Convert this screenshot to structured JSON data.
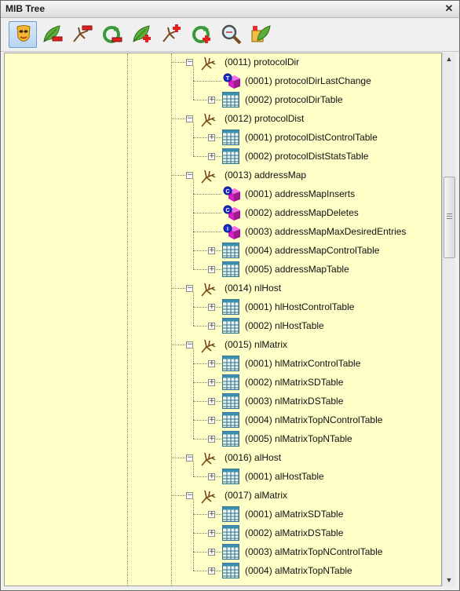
{
  "window": {
    "title": "MIB Tree",
    "close_symbol": "✕"
  },
  "toolbar": [
    {
      "name": "mask-icon",
      "active": true
    },
    {
      "name": "leaf-remove-icon"
    },
    {
      "name": "branch-remove-icon"
    },
    {
      "name": "refresh-remove-icon"
    },
    {
      "name": "leaf-add-icon"
    },
    {
      "name": "branch-add-icon"
    },
    {
      "name": "refresh-add-icon"
    },
    {
      "name": "magnifier-icon"
    },
    {
      "name": "export-leaf-icon"
    }
  ],
  "tree": {
    "nodes": [
      {
        "level": 0,
        "type": "branch",
        "label": "(0011) protocolDir",
        "expanded": true
      },
      {
        "level": 1,
        "type": "scalar",
        "badge": "T",
        "color": "#d020c0",
        "label": "(0001) protocolDirLastChange"
      },
      {
        "level": 1,
        "type": "table",
        "label": "(0002) protocolDirTable"
      },
      {
        "level": 0,
        "type": "branch",
        "label": "(0012) protocolDist",
        "expanded": true
      },
      {
        "level": 1,
        "type": "table",
        "label": "(0001) protocolDistControlTable"
      },
      {
        "level": 1,
        "type": "table",
        "label": "(0002) protocolDistStatsTable"
      },
      {
        "level": 0,
        "type": "branch",
        "label": "(0013) addressMap",
        "expanded": true
      },
      {
        "level": 1,
        "type": "scalar",
        "badge": "C",
        "color": "#d020c0",
        "label": "(0001) addressMapInserts"
      },
      {
        "level": 1,
        "type": "scalar",
        "badge": "C",
        "color": "#d020c0",
        "label": "(0002) addressMapDeletes"
      },
      {
        "level": 1,
        "type": "scalar",
        "badge": "I",
        "color": "#d020c0",
        "label": "(0003) addressMapMaxDesiredEntries"
      },
      {
        "level": 1,
        "type": "table",
        "label": "(0004) addressMapControlTable"
      },
      {
        "level": 1,
        "type": "table",
        "label": "(0005) addressMapTable"
      },
      {
        "level": 0,
        "type": "branch",
        "label": "(0014) nlHost",
        "expanded": true
      },
      {
        "level": 1,
        "type": "table",
        "label": "(0001) hlHostControlTable"
      },
      {
        "level": 1,
        "type": "table",
        "label": "(0002) nlHostTable"
      },
      {
        "level": 0,
        "type": "branch",
        "label": "(0015) nlMatrix",
        "expanded": true
      },
      {
        "level": 1,
        "type": "table",
        "label": "(0001) hlMatrixControlTable"
      },
      {
        "level": 1,
        "type": "table",
        "label": "(0002) nlMatrixSDTable"
      },
      {
        "level": 1,
        "type": "table",
        "label": "(0003) nlMatrixDSTable"
      },
      {
        "level": 1,
        "type": "table",
        "label": "(0004) nlMatrixTopNControlTable"
      },
      {
        "level": 1,
        "type": "table",
        "label": "(0005) nlMatrixTopNTable"
      },
      {
        "level": 0,
        "type": "branch",
        "label": "(0016) alHost",
        "expanded": true
      },
      {
        "level": 1,
        "type": "table",
        "label": "(0001) alHostTable"
      },
      {
        "level": 0,
        "type": "branch",
        "label": "(0017) alMatrix",
        "expanded": true
      },
      {
        "level": 1,
        "type": "table",
        "label": "(0001) alMatrixSDTable"
      },
      {
        "level": 1,
        "type": "table",
        "label": "(0002) alMatrixDSTable"
      },
      {
        "level": 1,
        "type": "table",
        "label": "(0003) alMatrixTopNControlTable"
      },
      {
        "level": 1,
        "type": "table",
        "label": "(0004) alMatrixTopNTable"
      }
    ]
  },
  "scrollbar": {
    "up_symbol": "▲",
    "down_symbol": "▼",
    "position_fraction": 0.23
  },
  "colors": {
    "tree_background": "#ffffc8",
    "table_icon": "#2f7d9c",
    "scalar_cube": "#d020c0",
    "badge": "#1a2fd0"
  }
}
